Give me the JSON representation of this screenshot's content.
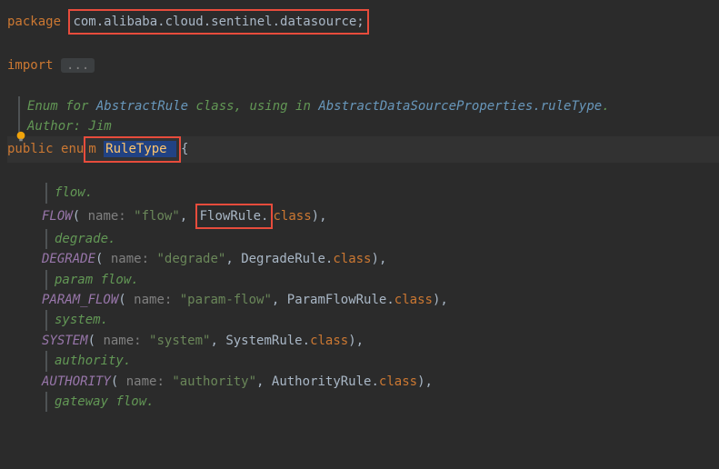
{
  "package_kw": "package ",
  "package_name": "com.alibaba.cloud.sentinel.datasource;",
  "import_kw": "import ",
  "import_fold": "...",
  "doc1_prefix": "Enum for ",
  "doc1_link1": "AbstractRule",
  "doc1_mid": " class, using in ",
  "doc1_link2": "AbstractDataSourceProperties.ruleType",
  "doc1_end": ".",
  "doc2": "Author: Jim",
  "decl_public": "public ",
  "decl_enu": "enu",
  "decl_m": "m ",
  "decl_name": "RuleType ",
  "decl_brace": "{",
  "items": [
    {
      "doc": "flow.",
      "name": "FLOW",
      "label": "\"flow\"",
      "rule": "FlowRule",
      "boxed": true
    },
    {
      "doc": "degrade.",
      "name": "DEGRADE",
      "label": "\"degrade\"",
      "rule": "DegradeRule",
      "boxed": false
    },
    {
      "doc": "param flow.",
      "name": "PARAM_FLOW",
      "label": "\"param-flow\"",
      "rule": "ParamFlowRule",
      "boxed": false
    },
    {
      "doc": "system.",
      "name": "SYSTEM",
      "label": "\"system\"",
      "rule": "SystemRule",
      "boxed": false
    },
    {
      "doc": "authority.",
      "name": "AUTHORITY",
      "label": "\"authority\"",
      "rule": "AuthorityRule",
      "boxed": false
    },
    {
      "doc": "gateway flow.",
      "name": "",
      "label": "",
      "rule": "",
      "boxed": false
    }
  ],
  "name_hint": " name: ",
  "class_kw": "class",
  "dot": ".",
  "paren_open": "(",
  "paren_close": ")",
  "comma": ",",
  "comma_sp": ", "
}
